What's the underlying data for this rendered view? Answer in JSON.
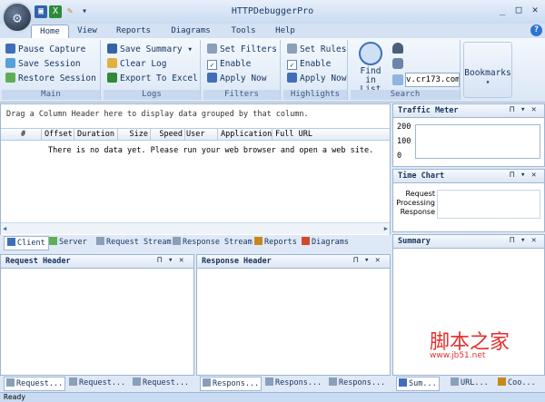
{
  "window": {
    "title": "HTTPDebuggerPro",
    "min": "_",
    "max": "□",
    "close": "✕",
    "qa_dropdown": "▾"
  },
  "tabs": [
    "Home",
    "View",
    "Reports",
    "Diagrams",
    "Tools",
    "Help"
  ],
  "help_icon": "?",
  "ribbon": {
    "main": {
      "label": "Main",
      "items": [
        "Pause Capture",
        "Save Session",
        "Restore Session"
      ]
    },
    "logs": {
      "label": "Logs",
      "items": [
        "Save Summary",
        "Clear Log",
        "Export To Excel"
      ],
      "dropdown": "▾"
    },
    "filters": {
      "label": "Filters",
      "items": [
        "Set Filters",
        "Enable",
        "Apply Now"
      ]
    },
    "highlights": {
      "label": "Highlights",
      "items": [
        "Set Rules",
        "Enable",
        "Apply Now"
      ]
    },
    "search": {
      "label": "Search",
      "find_label": "Find in List",
      "search_value": "v.cr173.com"
    },
    "bookmarks": {
      "label": "Bookmarks",
      "dropdown": "▾"
    }
  },
  "grid": {
    "group_hint": "Drag a Column Header here to display data grouped by that column.",
    "columns": [
      "#",
      "Offset",
      "Duration",
      "Size",
      "Speed",
      "User",
      "Application",
      "Full URL"
    ],
    "empty_message": "There is no data yet. Please run your web browser and open a web site."
  },
  "bottom_tabs": [
    "Client",
    "Server",
    "Request Stream",
    "Response Stream",
    "Reports",
    "Diagrams"
  ],
  "panels": {
    "request_header": "Request Header",
    "response_header": "Response Header",
    "traffic_meter": "Traffic Meter",
    "time_chart": "Time Chart",
    "summary": "Summary",
    "pin": "📌",
    "close": "✕"
  },
  "traffic_meter": {
    "y_ticks": [
      "200",
      "100",
      "0"
    ]
  },
  "time_chart": {
    "rows": [
      "Request",
      "Processing",
      "Response"
    ]
  },
  "request_tabs": [
    "Request...",
    "Request...",
    "Request..."
  ],
  "response_tabs": [
    "Respons...",
    "Respons...",
    "Respons..."
  ],
  "right_tabs": [
    "Sum...",
    "URL...",
    "Coo..."
  ],
  "status": "Ready",
  "watermark": {
    "text": "脚本之家",
    "url": "www.jb51.net"
  }
}
